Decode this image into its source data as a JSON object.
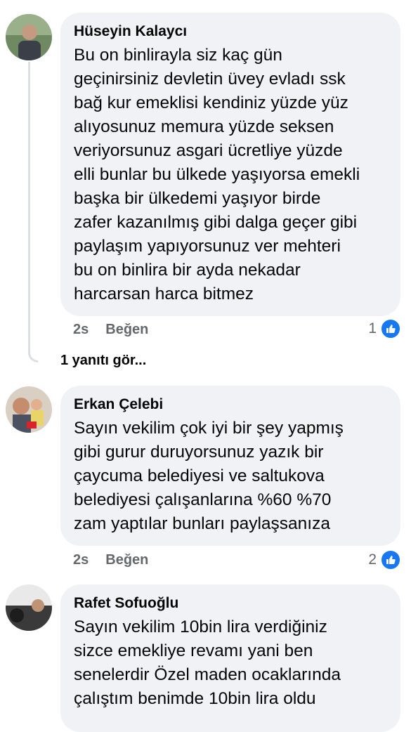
{
  "comments": [
    {
      "author": "Hüseyin Kalaycı",
      "lines": [
        "Bu on binlirayla siz kaç gün",
        "geçinirsiniz devletin üvey evladı ssk",
        "bağ kur emeklisi kendiniz yüzde yüz",
        "alıyosunuz memura yüzde seksen",
        "veriyorsunuz asgari ücretliye yüzde",
        "elli bunlar bu ülkede yaşıyorsa emekli",
        "başka bir ülkedemi yaşıyor birde",
        "zafer kazanılmış gibi dalga geçer gibi",
        "paylaşım yapıyorsunuz ver mehteri",
        "bu on binlira bir ayda nekadar",
        "harcarsan harca bitmez"
      ],
      "time": "2s",
      "like_label": "Beğen",
      "reaction_count": "1",
      "reaction_icon": "like-icon",
      "avatar_bg": "#7b8a6c",
      "view_replies": "1 yanıtı gör..."
    },
    {
      "author": "Erkan Çelebi",
      "lines": [
        "Sayın vekilim çok iyi bir şey yapmış",
        "gibi gurur duruyorsunuz yazık bir",
        "çaycuma belediyesi ve saltukova",
        "belediyesi çalışanlarına %60 %70",
        "zam yaptılar bunları paylaşsanıza"
      ],
      "time": "2s",
      "like_label": "Beğen",
      "reaction_count": "2",
      "reaction_icon": "like-icon",
      "avatar_bg": "#c9a98a"
    },
    {
      "author": "Rafet Sofuoğlu",
      "lines": [
        "Sayın vekilim 10bin lira verdiğiniz",
        "sizce emekliye revamı yani ben",
        "senelerdir Özel maden ocaklarında",
        "çalıştım  benimde 10bin lira oldu"
      ],
      "avatar_bg": "#3a3a3a"
    }
  ],
  "colors": {
    "bubble": "#f0f2f5",
    "secondary_text": "#65676b",
    "like_blue": "#1877f2",
    "thread_line": "#dcdfe3"
  }
}
